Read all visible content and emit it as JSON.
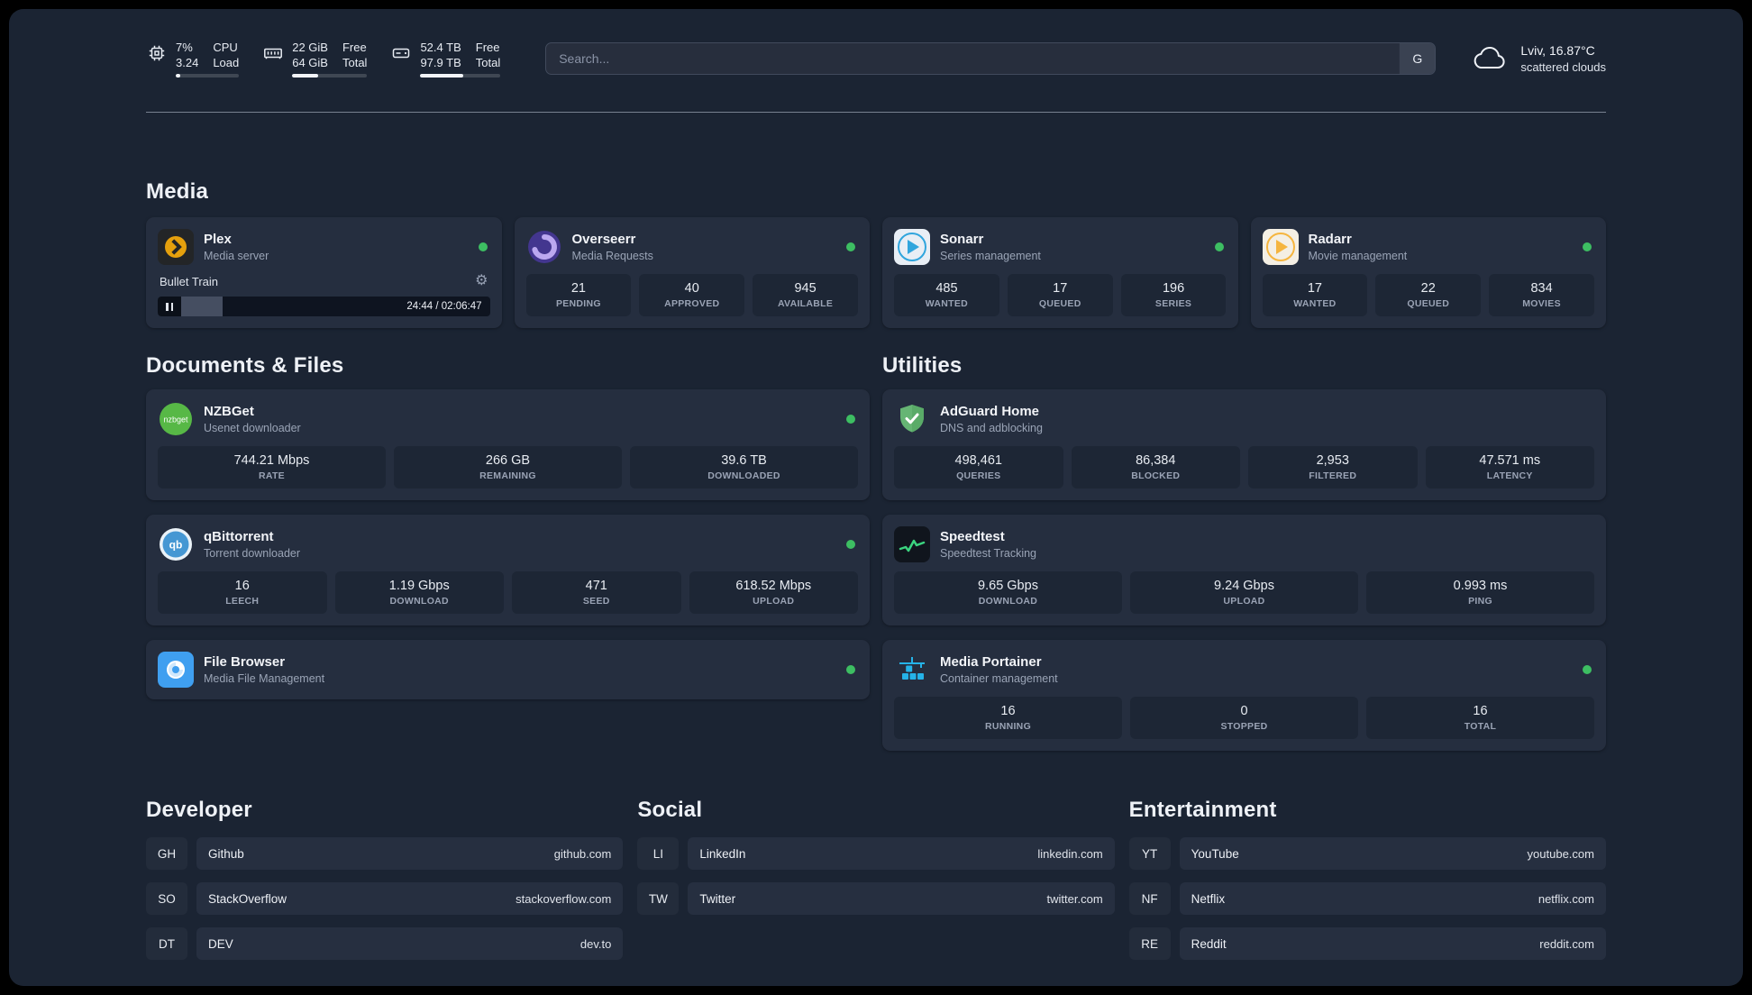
{
  "topbar": {
    "cpu": {
      "line1": "7%",
      "line2": "3.24",
      "label_line1": "CPU",
      "label_line2": "Load",
      "percent": 7
    },
    "ram": {
      "line1": "22 GiB",
      "line2": "64 GiB",
      "label_line1": "Free",
      "label_line2": "Total",
      "percent": 34
    },
    "disk": {
      "line1": "52.4 TB",
      "line2": "97.9 TB",
      "label_line1": "Free",
      "label_line2": "Total",
      "percent": 54
    },
    "search": {
      "placeholder": "Search...",
      "button_label": "G"
    },
    "weather": {
      "location": "Lviv, 16.87°C",
      "condition": "scattered clouds"
    }
  },
  "media": {
    "heading": "Media",
    "plex": {
      "title": "Plex",
      "subtitle": "Media server",
      "now_playing": "Bullet Train",
      "time": "24:44 / 02:06:47",
      "progress_percent": 19.5
    },
    "overseerr": {
      "title": "Overseerr",
      "subtitle": "Media Requests",
      "stats": [
        {
          "value": "21",
          "label": "PENDING"
        },
        {
          "value": "40",
          "label": "APPROVED"
        },
        {
          "value": "945",
          "label": "AVAILABLE"
        }
      ]
    },
    "sonarr": {
      "title": "Sonarr",
      "subtitle": "Series management",
      "stats": [
        {
          "value": "485",
          "label": "WANTED"
        },
        {
          "value": "17",
          "label": "QUEUED"
        },
        {
          "value": "196",
          "label": "SERIES"
        }
      ]
    },
    "radarr": {
      "title": "Radarr",
      "subtitle": "Movie management",
      "stats": [
        {
          "value": "17",
          "label": "WANTED"
        },
        {
          "value": "22",
          "label": "QUEUED"
        },
        {
          "value": "834",
          "label": "MOVIES"
        }
      ]
    }
  },
  "documents": {
    "heading": "Documents & Files",
    "nzbget": {
      "title": "NZBGet",
      "subtitle": "Usenet downloader",
      "stats": [
        {
          "value": "744.21 Mbps",
          "label": "RATE"
        },
        {
          "value": "266 GB",
          "label": "REMAINING"
        },
        {
          "value": "39.6 TB",
          "label": "DOWNLOADED"
        }
      ]
    },
    "qbittorrent": {
      "title": "qBittorrent",
      "subtitle": "Torrent downloader",
      "stats": [
        {
          "value": "16",
          "label": "LEECH"
        },
        {
          "value": "1.19 Gbps",
          "label": "DOWNLOAD"
        },
        {
          "value": "471",
          "label": "SEED"
        },
        {
          "value": "618.52 Mbps",
          "label": "UPLOAD"
        }
      ]
    },
    "filebrowser": {
      "title": "File Browser",
      "subtitle": "Media File Management"
    }
  },
  "utilities": {
    "heading": "Utilities",
    "adguard": {
      "title": "AdGuard Home",
      "subtitle": "DNS and adblocking",
      "stats": [
        {
          "value": "498,461",
          "label": "QUERIES"
        },
        {
          "value": "86,384",
          "label": "BLOCKED"
        },
        {
          "value": "2,953",
          "label": "FILTERED"
        },
        {
          "value": "47.571 ms",
          "label": "LATENCY"
        }
      ]
    },
    "speedtest": {
      "title": "Speedtest",
      "subtitle": "Speedtest Tracking",
      "stats": [
        {
          "value": "9.65 Gbps",
          "label": "DOWNLOAD"
        },
        {
          "value": "9.24 Gbps",
          "label": "UPLOAD"
        },
        {
          "value": "0.993 ms",
          "label": "PING"
        }
      ]
    },
    "portainer": {
      "title": "Media Portainer",
      "subtitle": "Container management",
      "stats": [
        {
          "value": "16",
          "label": "RUNNING"
        },
        {
          "value": "0",
          "label": "STOPPED"
        },
        {
          "value": "16",
          "label": "TOTAL"
        }
      ]
    }
  },
  "bookmarks": [
    {
      "heading": "Developer",
      "items": [
        {
          "abbr": "GH",
          "name": "Github",
          "url": "github.com"
        },
        {
          "abbr": "SO",
          "name": "StackOverflow",
          "url": "stackoverflow.com"
        },
        {
          "abbr": "DT",
          "name": "DEV",
          "url": "dev.to"
        }
      ]
    },
    {
      "heading": "Social",
      "items": [
        {
          "abbr": "LI",
          "name": "LinkedIn",
          "url": "linkedin.com"
        },
        {
          "abbr": "TW",
          "name": "Twitter",
          "url": "twitter.com"
        }
      ]
    },
    {
      "heading": "Entertainment",
      "items": [
        {
          "abbr": "YT",
          "name": "YouTube",
          "url": "youtube.com"
        },
        {
          "abbr": "NF",
          "name": "Netflix",
          "url": "netflix.com"
        },
        {
          "abbr": "RE",
          "name": "Reddit",
          "url": "reddit.com"
        }
      ]
    }
  ],
  "icons": {
    "gear": "⚙"
  },
  "colors": {
    "page_background": "#1b2433",
    "card_background": "#252e3f",
    "stat_background": "#1d2635",
    "status_online": "#3dbe62",
    "plex_amber": "#e5a00d",
    "overseerr_purple": "#43368f",
    "sonarr_blue": "#30a5dd",
    "radarr_amber": "#f5b53f",
    "nzbget_green": "#57b846",
    "qbittorrent_blue": "#4597d3",
    "filebrowser_blue": "#3f9ff0",
    "adguard_green": "#66b574",
    "speedtest_green": "#3bd47f",
    "portainer_blue": "#25b3e8"
  }
}
